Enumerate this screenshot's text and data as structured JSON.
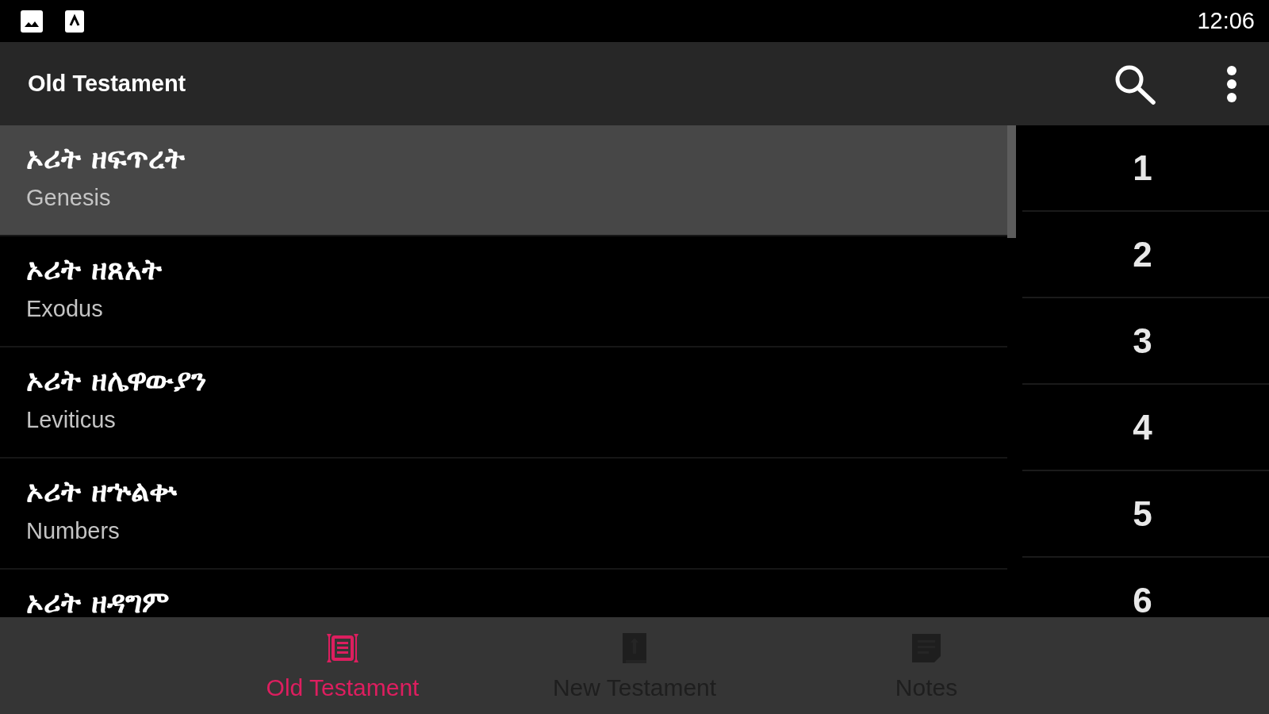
{
  "status_bar": {
    "time": "12:06"
  },
  "app_bar": {
    "title": "Old Testament"
  },
  "books": [
    {
      "title": "ኦሪት ዘፍጥረት",
      "subtitle": "Genesis",
      "selected": true
    },
    {
      "title": "ኦሪት ዘጸአት",
      "subtitle": "Exodus",
      "selected": false
    },
    {
      "title": "ኦሪት ዘሌዋውያን",
      "subtitle": "Leviticus",
      "selected": false
    },
    {
      "title": "ኦሪት ዘኍልቍ",
      "subtitle": "Numbers",
      "selected": false
    },
    {
      "title": "ኦሪት ዘዳግም",
      "selected": false
    }
  ],
  "chapters": [
    "1",
    "2",
    "3",
    "4",
    "5",
    "6"
  ],
  "bottom_nav": [
    {
      "label": "Old Testament",
      "selected": true
    },
    {
      "label": "New Testament",
      "selected": false
    },
    {
      "label": "Notes",
      "selected": false
    }
  ]
}
